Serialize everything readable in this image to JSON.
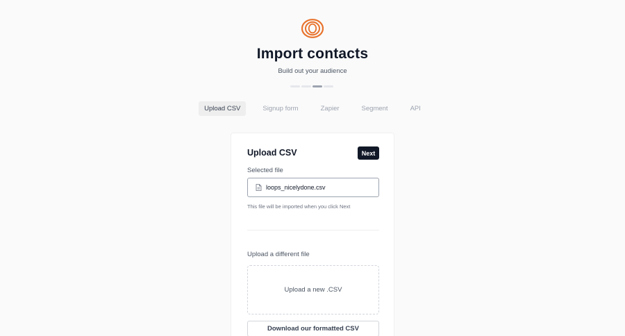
{
  "header": {
    "logo_icon": "loops-ring-logo",
    "title": "Import contacts",
    "subtitle": "Build out your audience",
    "progress": {
      "total_steps": 4,
      "current_step": 3
    },
    "accent_color": "#e8722c"
  },
  "tabs": [
    {
      "label": "Upload CSV",
      "active": true
    },
    {
      "label": "Signup form",
      "active": false
    },
    {
      "label": "Zapier",
      "active": false
    },
    {
      "label": "Segment",
      "active": false
    },
    {
      "label": "API",
      "active": false
    }
  ],
  "card": {
    "title": "Upload CSV",
    "next_label": "Next",
    "selected_file_label": "Selected file",
    "file_icon": "document-icon",
    "file_name": "loops_nicelydone.csv",
    "hint": "This file will be imported when you click Next",
    "upload_different_label": "Upload a different file",
    "dropzone_label": "Upload a new .CSV",
    "download_label": "Download our formatted CSV"
  }
}
